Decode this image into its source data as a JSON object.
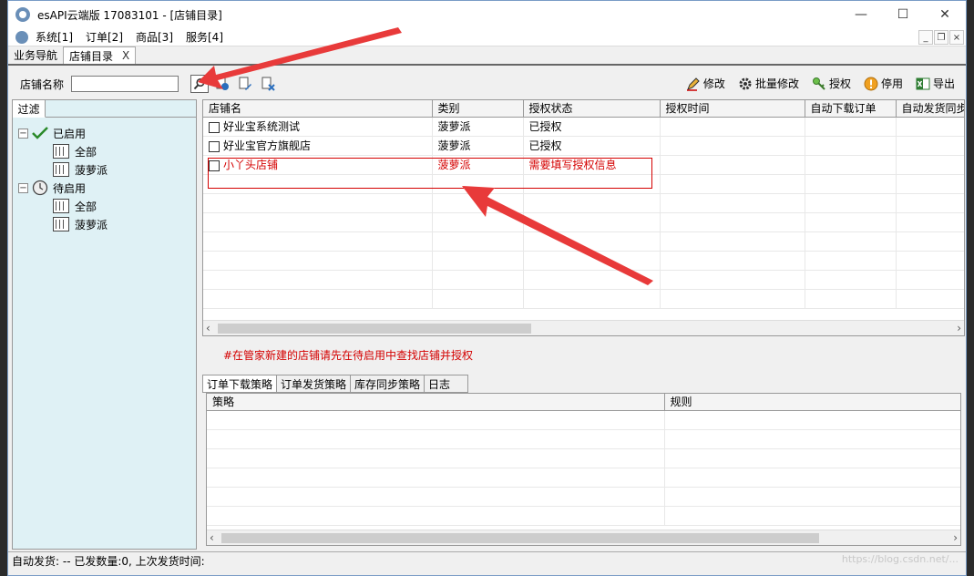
{
  "window": {
    "title": "esAPI云端版 17083101 - [店铺目录]",
    "minimize": "—",
    "maximize": "☐",
    "close": "✕"
  },
  "menu": {
    "items": [
      "系统[1]",
      "订单[2]",
      "商品[3]",
      "服务[4]"
    ],
    "mdi_min": "_",
    "mdi_restore": "❐",
    "mdi_close": "×"
  },
  "tabs": [
    {
      "label": "业务导航"
    },
    {
      "label": "店铺目录",
      "close": "X"
    }
  ],
  "toolbar": {
    "search_label": "店铺名称",
    "search_value": "",
    "actions": [
      {
        "label": "修改",
        "icon": "pencil-icon"
      },
      {
        "label": "批量修改",
        "icon": "gear-icon"
      },
      {
        "label": "授权",
        "icon": "key-icon"
      },
      {
        "label": "停用",
        "icon": "warning-icon"
      },
      {
        "label": "导出",
        "icon": "excel-icon"
      }
    ]
  },
  "filter_panel": {
    "tab_label": "过滤",
    "tree": [
      {
        "label": "已启用",
        "icon": "check-icon",
        "children": [
          "全部",
          "菠萝派"
        ]
      },
      {
        "label": "待启用",
        "icon": "clock-icon",
        "children": [
          "全部",
          "菠萝派"
        ]
      }
    ]
  },
  "shop_table": {
    "columns": [
      "店铺名",
      "类别",
      "授权状态",
      "授权时间",
      "自动下载订单",
      "自动发货同步"
    ],
    "rows": [
      {
        "name": "好业宝系统测试",
        "category": "菠萝派",
        "status": "已授权",
        "highlight": false
      },
      {
        "name": "好业宝官方旗舰店",
        "category": "菠萝派",
        "status": "已授权",
        "highlight": false
      },
      {
        "name": "小丫头店铺",
        "category": "菠萝派",
        "status": "需要填写授权信息",
        "highlight": true
      }
    ]
  },
  "notice": "#在管家新建的店铺请先在待启用中查找店铺并授权",
  "strategy_tabs": [
    "订单下载策略",
    "订单发货策略",
    "库存同步策略",
    "日志"
  ],
  "strategy_table": {
    "columns": [
      "策略",
      "规则"
    ]
  },
  "status_bar": "自动发货: -- 已发数量:0, 上次发货时间:",
  "watermark": "https://blog.csdn.net/..."
}
